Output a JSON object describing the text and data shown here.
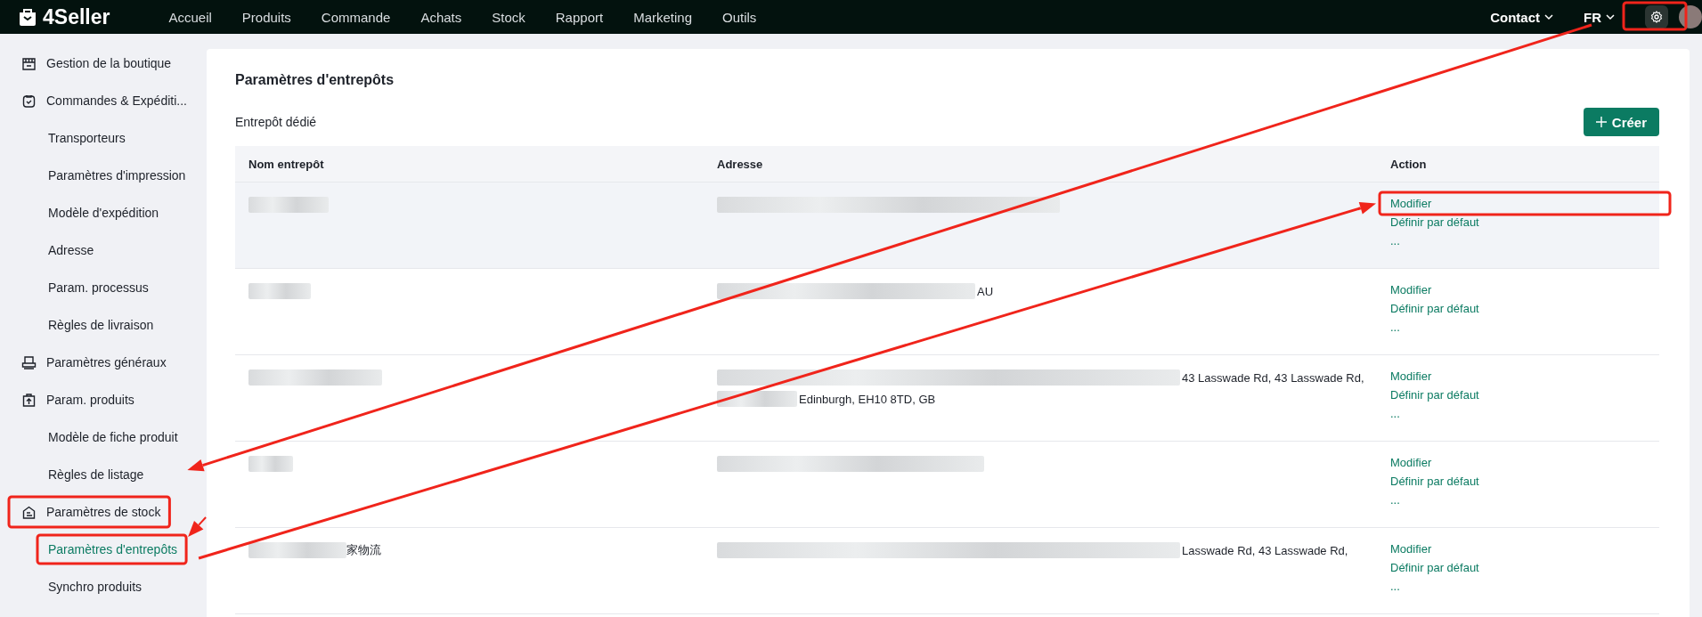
{
  "topbar": {
    "logo": "4Seller",
    "nav": [
      {
        "label": "Accueil"
      },
      {
        "label": "Produits"
      },
      {
        "label": "Commande"
      },
      {
        "label": "Achats"
      },
      {
        "label": "Stock"
      },
      {
        "label": "Rapport"
      },
      {
        "label": "Marketing"
      },
      {
        "label": "Outils"
      }
    ],
    "contact": "Contact",
    "language": "FR"
  },
  "sidebar": {
    "items": [
      {
        "label": "Gestion de la boutique",
        "kind": "group",
        "selected": false
      },
      {
        "label": "Commandes & Expéditi...",
        "kind": "group",
        "selected": false
      },
      {
        "label": "Transporteurs",
        "kind": "sub",
        "selected": false
      },
      {
        "label": "Paramètres d'impression",
        "kind": "sub",
        "selected": false
      },
      {
        "label": "Modèle d'expédition",
        "kind": "sub",
        "selected": false
      },
      {
        "label": "Adresse",
        "kind": "sub",
        "selected": false
      },
      {
        "label": "Param. processus",
        "kind": "sub",
        "selected": false
      },
      {
        "label": "Règles de livraison",
        "kind": "sub",
        "selected": false
      },
      {
        "label": "Paramètres généraux",
        "kind": "group",
        "selected": false
      },
      {
        "label": "Param. produits",
        "kind": "group",
        "selected": false
      },
      {
        "label": "Modèle de fiche produit",
        "kind": "sub",
        "selected": false
      },
      {
        "label": "Règles de listage",
        "kind": "sub",
        "selected": false
      },
      {
        "label": "Paramètres de stock",
        "kind": "group",
        "selected": false
      },
      {
        "label": "Paramètres d'entrepôts",
        "kind": "sub",
        "selected": true
      },
      {
        "label": "Synchro produits",
        "kind": "sub",
        "selected": false
      }
    ]
  },
  "page": {
    "title": "Paramètres d'entrepôts",
    "section": "Entrepôt dédié",
    "create_button": "Créer"
  },
  "table": {
    "columns": [
      "Nom entrepôt",
      "Adresse",
      "Action"
    ],
    "rows": [
      {
        "highlighted": true,
        "name": "",
        "address": [],
        "actions": [
          "Modifier",
          "Définir par défaut",
          "..."
        ]
      },
      {
        "highlighted": false,
        "name": "",
        "address": [
          "AU"
        ],
        "actions": [
          "Modifier",
          "Définir par défaut",
          "..."
        ]
      },
      {
        "highlighted": false,
        "name": "",
        "address": [
          "43 Lasswade Rd, 43 Lasswade Rd,",
          "Edinburgh, EH10 8TD, GB"
        ],
        "actions": [
          "Modifier",
          "Définir par défaut",
          "..."
        ]
      },
      {
        "highlighted": false,
        "name": "",
        "address": [],
        "actions": [
          "Modifier",
          "Définir par défaut",
          "..."
        ]
      },
      {
        "highlighted": false,
        "name": "家物流",
        "address": [
          "Lasswade Rd, 43 Lasswade Rd,"
        ],
        "actions": [
          "Modifier",
          "Définir par défaut",
          "..."
        ]
      }
    ]
  }
}
